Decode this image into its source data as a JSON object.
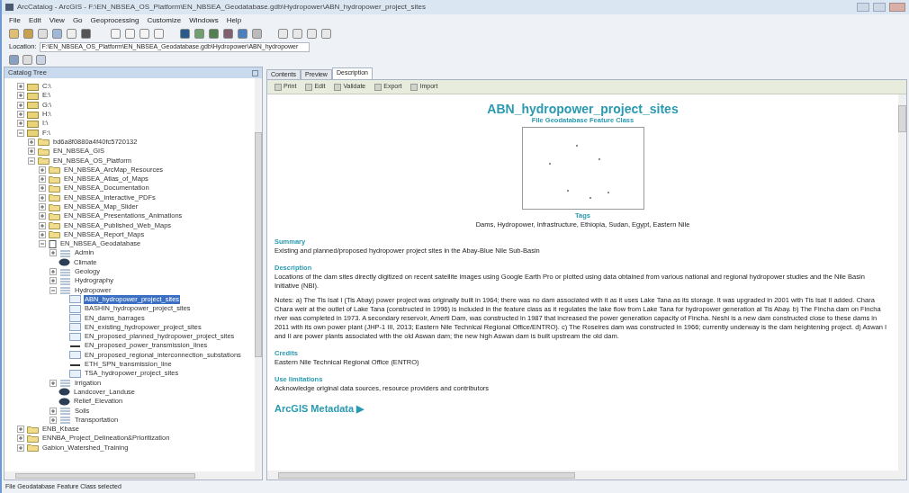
{
  "window": {
    "title": "ArcCatalog - ArcGIS - F:\\EN_NBSEA_OS_Platform\\EN_NBSEA_Geodatabase.gdb\\Hydropower\\ABN_hydropower_project_sites"
  },
  "menu": [
    "File",
    "Edit",
    "View",
    "Go",
    "Geoprocessing",
    "Customize",
    "Windows",
    "Help"
  ],
  "location": {
    "label": "Location:",
    "value": "F:\\EN_NBSEA_OS_Platform\\EN_NBSEA_Geodatabase.gdb\\Hydropower\\ABN_hydropower"
  },
  "catalog_tree": {
    "title": "Catalog Tree",
    "items": [
      {
        "label": "C:\\",
        "kind": "drive",
        "expanded": false,
        "selected": false
      },
      {
        "label": "E:\\",
        "kind": "drive",
        "expanded": false,
        "selected": false
      },
      {
        "label": "G:\\",
        "kind": "drive",
        "expanded": false,
        "selected": false
      },
      {
        "label": "H:\\",
        "kind": "drive",
        "expanded": false,
        "selected": false
      },
      {
        "label": "I:\\",
        "kind": "drive",
        "expanded": false,
        "selected": false
      },
      {
        "label": "F:\\",
        "kind": "drive",
        "expanded": true,
        "selected": false,
        "children": [
          {
            "label": "bd6a8f0880a4f40fc5720132",
            "kind": "folder",
            "expanded": false,
            "selected": false
          },
          {
            "label": "EN_NBSEA_GIS",
            "kind": "folder",
            "expanded": false,
            "selected": false
          },
          {
            "label": "EN_NBSEA_OS_Platform",
            "kind": "folder",
            "expanded": true,
            "selected": false,
            "children": [
              {
                "label": "EN_NBSEA_ArcMap_Resources",
                "kind": "folder",
                "expanded": false,
                "selected": false
              },
              {
                "label": "EN_NBSEA_Atlas_of_Maps",
                "kind": "folder",
                "expanded": false,
                "selected": false
              },
              {
                "label": "EN_NBSEA_Documentation",
                "kind": "folder",
                "expanded": false,
                "selected": false
              },
              {
                "label": "EN_NBSEA_Interactive_PDFs",
                "kind": "folder",
                "expanded": false,
                "selected": false
              },
              {
                "label": "EN_NBSEA_Map_Slider",
                "kind": "folder",
                "expanded": false,
                "selected": false
              },
              {
                "label": "EN_NBSEA_Presentations_Animations",
                "kind": "folder",
                "expanded": false,
                "selected": false
              },
              {
                "label": "EN_NBSEA_Published_Web_Maps",
                "kind": "folder",
                "expanded": false,
                "selected": false
              },
              {
                "label": "EN_NBSEA_Report_Maps",
                "kind": "folder",
                "expanded": false,
                "selected": false
              },
              {
                "label": "EN_NBSEA_Geodatabase",
                "kind": "gdb",
                "expanded": true,
                "selected": false,
                "children": [
                  {
                    "label": "Admin",
                    "kind": "dataset",
                    "expanded": false,
                    "selected": false
                  },
                  {
                    "label": "Climate",
                    "kind": "raster",
                    "selected": false
                  },
                  {
                    "label": "Geology",
                    "kind": "dataset",
                    "expanded": false,
                    "selected": false
                  },
                  {
                    "label": "Hydrography",
                    "kind": "dataset",
                    "expanded": false,
                    "selected": false
                  },
                  {
                    "label": "Hydropower",
                    "kind": "dataset",
                    "expanded": true,
                    "selected": false,
                    "children": [
                      {
                        "label": "ABN_hydropower_project_sites",
                        "kind": "point",
                        "selected": true
                      },
                      {
                        "label": "BASHIN_hydropower_project_sites",
                        "kind": "point",
                        "selected": false
                      },
                      {
                        "label": "EN_dams_barrages",
                        "kind": "point",
                        "selected": false
                      },
                      {
                        "label": "EN_existing_hydropower_project_sites",
                        "kind": "point",
                        "selected": false
                      },
                      {
                        "label": "EN_proposed_planned_hydropower_project_sites",
                        "kind": "point",
                        "selected": false
                      },
                      {
                        "label": "EN_proposed_power_transmission_lines",
                        "kind": "line",
                        "selected": false
                      },
                      {
                        "label": "EN_proposed_regional_interconnection_substations",
                        "kind": "point",
                        "selected": false
                      },
                      {
                        "label": "ETH_SPN_transmission_line",
                        "kind": "line",
                        "selected": false
                      },
                      {
                        "label": "TSA_hydropower_project_sites",
                        "kind": "point",
                        "selected": false
                      }
                    ]
                  },
                  {
                    "label": "Irrigation",
                    "kind": "dataset",
                    "expanded": false,
                    "selected": false
                  },
                  {
                    "label": "Landcover_Landuse",
                    "kind": "raster",
                    "selected": false
                  },
                  {
                    "label": "Relief_Elevation",
                    "kind": "raster",
                    "selected": false
                  },
                  {
                    "label": "Soils",
                    "kind": "dataset",
                    "expanded": false,
                    "selected": false
                  },
                  {
                    "label": "Transportation",
                    "kind": "dataset",
                    "expanded": false,
                    "selected": false
                  }
                ]
              }
            ]
          }
        ]
      },
      {
        "label": "ENB_Kbase",
        "kind": "folder",
        "expanded": false,
        "selected": false
      },
      {
        "label": "ENNBA_Project_Delineation&Prioritization",
        "kind": "folder",
        "expanded": false,
        "selected": false
      },
      {
        "label": "Gabion_Watershed_Training",
        "kind": "folder",
        "expanded": false,
        "selected": false
      }
    ]
  },
  "tabs": [
    {
      "label": "Contents",
      "selected": false
    },
    {
      "label": "Preview",
      "selected": false
    },
    {
      "label": "Description",
      "selected": true
    }
  ],
  "description_toolbar": [
    "Print",
    "Edit",
    "Validate",
    "Export",
    "Import"
  ],
  "metadata": {
    "title": "ABN_hydropower_project_sites",
    "subtitle": "File Geodatabase Feature Class",
    "tags_heading": "Tags",
    "tags": "Dams, Hydropower, Infrastructure, Ethiopia, Sudan, Egypt, Eastern Nile",
    "sections": [
      {
        "heading": "Summary",
        "paragraphs": [
          "Existing and planned/proposed hydropower project sites in the Abay-Blue Nile Sub-Basin"
        ]
      },
      {
        "heading": "Description",
        "paragraphs": [
          "Locations of the dam sites directly digitized on recent satellite images using Google Earth Pro or plotted using data obtained from various national and regional hydropower studies and the Nile Basin Initiative (NBI).",
          "Notes: a) The Tis Isat I (Tis Abay) power project was originally built in 1964; there was no dam associated with it as it uses Lake Tana as its storage. It was upgraded in 2001 with Tis Isat II added. Chara Chara weir at the outlet of Lake Tana (constructed in 1996) is included in the feature class as it regulates the lake flow from Lake Tana for hydropower generation at Tis Abay. b) The Fincha dam on Fincha river was completed in 1973. A secondary reservoir, Amerti Dam, was constructed in 1987 that increased the power generation capacity of Fincha. Neshi is a new dam constructed close to these dams in 2011 with its own power plant (JHP-1 III, 2013; Eastern Nile Technical Regional Office/ENTRO). c) The Roseires dam was constructed in 1966; currently underway is the dam heightening project. d) Aswan I and II are power plants associated with the old Aswan dam; the new high Aswan dam is built upstream the old dam."
        ]
      },
      {
        "heading": "Credits",
        "paragraphs": [
          "Eastern Nile Technical Regional Office (ENTRO)"
        ]
      },
      {
        "heading": "Use limitations",
        "paragraphs": [
          "Acknowledge original data sources, resource providers and contributors"
        ]
      }
    ],
    "footer_link": "ArcGIS Metadata ▶"
  },
  "status_bar": "File Geodatabase Feature Class selected"
}
